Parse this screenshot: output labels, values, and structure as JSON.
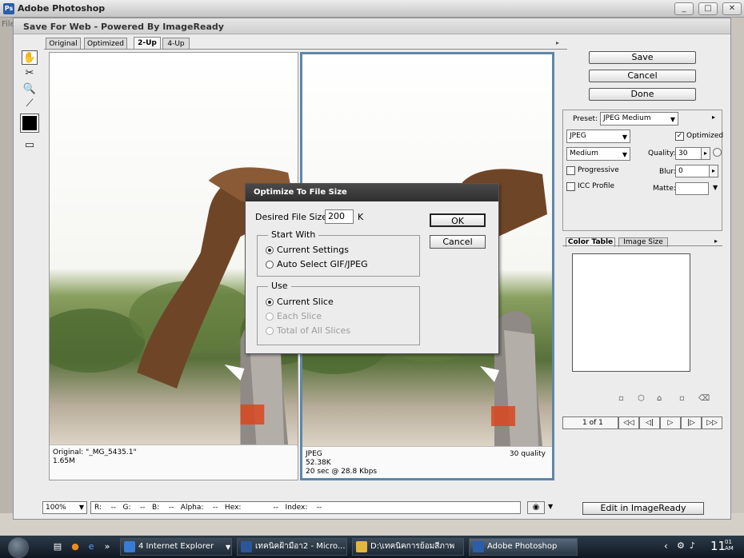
{
  "app": {
    "title": "Adobe Photoshop",
    "menu_first": "File",
    "window_buttons": [
      "_",
      "□",
      "✕"
    ]
  },
  "dialog": {
    "title": "Save For Web - Powered By ImageReady",
    "tabs": [
      "Original",
      "Optimized",
      "2-Up",
      "4-Up"
    ],
    "active_tab": "2-Up",
    "buttons": {
      "save": "Save",
      "cancel": "Cancel",
      "done": "Done"
    },
    "preset_label": "Preset:",
    "preset_value": "JPEG Medium",
    "format_value": "JPEG",
    "quality_preset": "Medium",
    "optimized_label": "Optimized",
    "quality_label": "Quality:",
    "quality_value": "30",
    "progressive_label": "Progressive",
    "blur_label": "Blur:",
    "blur_value": "0",
    "icc_label": "ICC Profile",
    "matte_label": "Matte:",
    "color_table_tab": "Color Table",
    "image_size_tab": "Image Size",
    "pager": {
      "label": "1 of 1",
      "buttons": [
        "◁◁",
        "◁|",
        "▷",
        "|▷",
        "▷▷"
      ]
    },
    "zoom": "100%",
    "readout": "R:    --   G:    --   B:    --   Alpha:    --   Hex:              --   Index:    --",
    "edit_in_imageready": "Edit in ImageReady"
  },
  "left_pane": {
    "line1": "Original: \"_MG_5435.1\"",
    "line2": "1.65M"
  },
  "right_pane": {
    "line1": "JPEG",
    "line2": "52.38K",
    "line3": "20 sec @ 28.8 Kbps",
    "quality": "30 quality"
  },
  "modal": {
    "title": "Optimize To File Size",
    "desired_label": "Desired File Size:",
    "desired_value": "200",
    "unit": "K",
    "ok": "OK",
    "cancel": "Cancel",
    "start_with_title": "Start With",
    "start_with_options": [
      "Current Settings",
      "Auto Select GIF/JPEG"
    ],
    "use_title": "Use",
    "use_options": [
      "Current Slice",
      "Each Slice",
      "Total of All Slices"
    ]
  },
  "taskbar": {
    "buttons": [
      "4 Internet Explorer",
      "เทคนิคฝ้ามือา2 - Micro...",
      "D:\\เทคนิคการย้อมสีภาพ",
      "Adobe Photoshop"
    ],
    "clock": "11",
    "ampm": "01\nAM",
    "chevron": "»"
  }
}
